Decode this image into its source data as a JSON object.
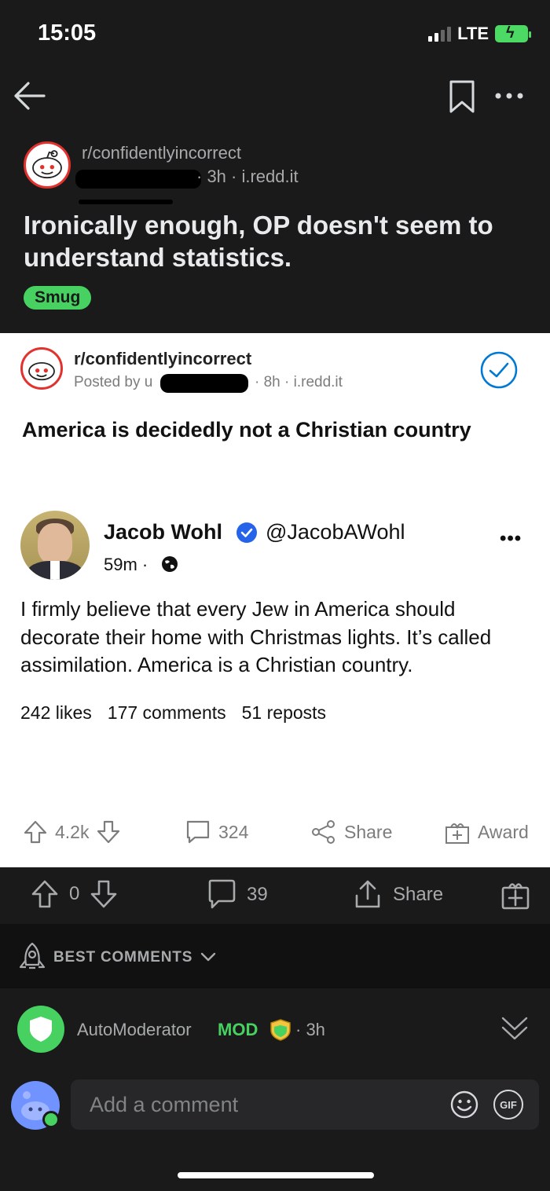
{
  "status_bar": {
    "time": "15:05",
    "network": "LTE"
  },
  "post": {
    "subreddit": "r/confidentlyincorrect",
    "meta": "· 3h · i.redd.it",
    "title": "Ironically enough, OP doesn't seem to understand statistics.",
    "flair": "Smug",
    "flair_color": "#46d160"
  },
  "embed": {
    "subreddit": "r/confidentlyincorrect",
    "posted_by": "Posted by u",
    "meta": "· 8h · i.redd.it",
    "title": "America is decidedly not a Christian country",
    "tweet": {
      "name": "Jacob Wohl",
      "handle": "@JacobAWohl",
      "more": "•••",
      "time": "59m ·",
      "text": "I firmly believe that every Jew in America should decorate their home with Christmas lights. It’s called assimilation. America is a Christian country.",
      "likes": "242 likes",
      "comments": "177 comments",
      "reposts": "51 reposts"
    },
    "actions": {
      "votes": "4.2k",
      "comments": "324",
      "share": "Share",
      "award": "Award"
    }
  },
  "actions": {
    "votes": "0",
    "comments": "39",
    "share": "Share"
  },
  "sort": {
    "label": "BEST COMMENTS"
  },
  "automod": {
    "name": "AutoModerator",
    "badge": "MOD",
    "time": "· 3h"
  },
  "composer": {
    "placeholder": "Add a comment",
    "gif": "GIF"
  },
  "icons": [
    "back-arrow-icon",
    "bookmark-icon",
    "more-icon",
    "upvote-icon",
    "downvote-icon",
    "comment-icon",
    "share-icon",
    "award-icon",
    "shield-icon",
    "emoji-icon",
    "gif-icon"
  ]
}
